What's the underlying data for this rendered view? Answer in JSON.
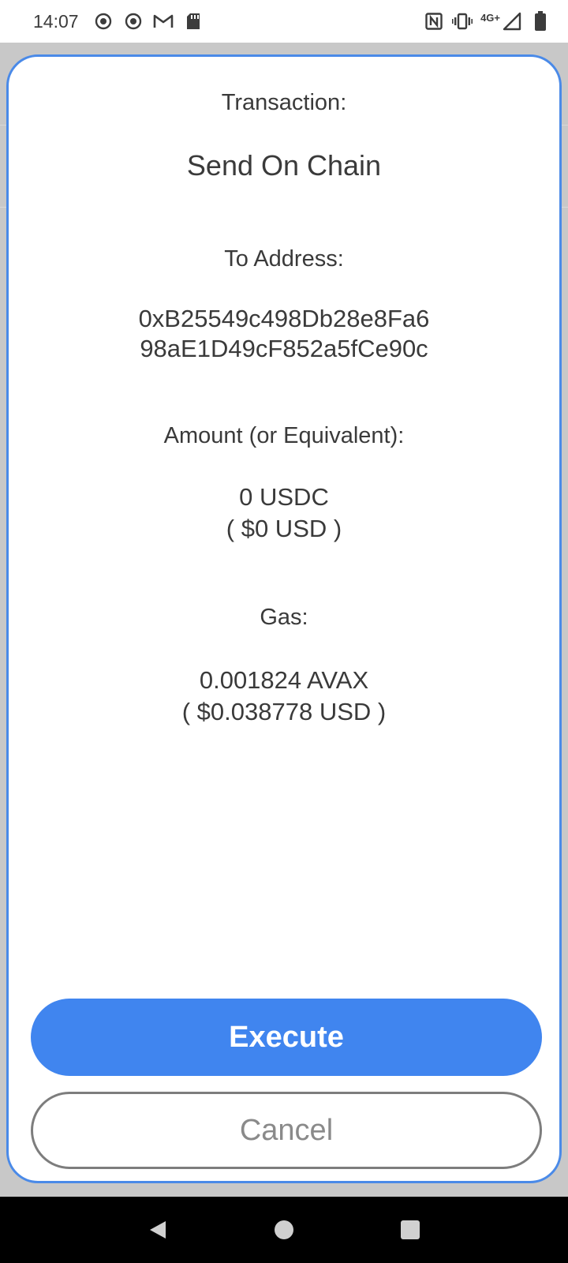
{
  "status_bar": {
    "time": "14:07",
    "left_icons": [
      "record-icon",
      "record-icon",
      "gmail-icon",
      "sd-card-icon"
    ],
    "right_icons": [
      "nfc-icon",
      "vibrate-icon",
      "signal-icon",
      "battery-icon"
    ],
    "network": "4G+"
  },
  "dialog": {
    "transaction_label": "Transaction:",
    "transaction_value": "Send On Chain",
    "to_address_label": "To Address:",
    "to_address_line1": "0xB25549c498Db28e8Fa6",
    "to_address_line2": "98aE1D49cF852a5fCe90c",
    "amount_label": "Amount (or Equivalent):",
    "amount_value": "0 USDC",
    "amount_usd": "( $0 USD )",
    "gas_label": "Gas:",
    "gas_value": "0.001824 AVAX",
    "gas_usd": "( $0.038778 USD )",
    "execute_label": "Execute",
    "cancel_label": "Cancel"
  },
  "nav_bar": {
    "buttons": [
      "back-icon",
      "home-icon",
      "recents-icon"
    ]
  },
  "colors": {
    "accent": "#4085ef",
    "dialog_border": "#4a8ae8",
    "text": "#3a3a3a"
  }
}
